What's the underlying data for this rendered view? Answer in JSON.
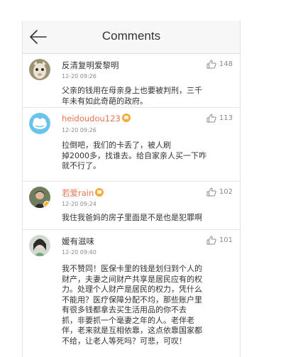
{
  "header": {
    "title": "Comments"
  },
  "comments": [
    {
      "username": "反清复明爱黎明",
      "time": "12-20 09:26",
      "likes": "148",
      "lines": [
        "父亲的钱用在母亲身上也要被判刑，三千",
        "年未有如此奇葩的政府。"
      ]
    },
    {
      "username": "heidoudou123",
      "time": "12-20 09:26",
      "likes": "113",
      "lines": [
        "拉倒吧，我们的卡丢了，被人刷",
        "掉2000多，找谁去。给自家亲人买一下咋",
        "就不行了。"
      ]
    },
    {
      "username": "若爱rain",
      "time": "12-20 09:24",
      "likes": "102",
      "lines": [
        "我住我爸妈的房子里面是不是也是犯罪啊"
      ]
    },
    {
      "username": "媛有滋味",
      "time": "12-20 09:40",
      "likes": "101",
      "lines": [
        "我不赞同！医保卡里的钱是划归到个人的",
        "财产，夫妻之间财产共享是居民应有的权",
        "力。处理个人财产是居民的权力，凭什么",
        "不能用？医疗保障分配不均，那些账户里",
        "有很多钱都拿去买生活用品的你不去",
        "抓，非要抓一个毫妻之年的人。老伴老",
        "伴，老来就是互相依靠，这点依靠国家都",
        "不给，让老人等死吗？可悲，可叹！"
      ]
    }
  ]
}
